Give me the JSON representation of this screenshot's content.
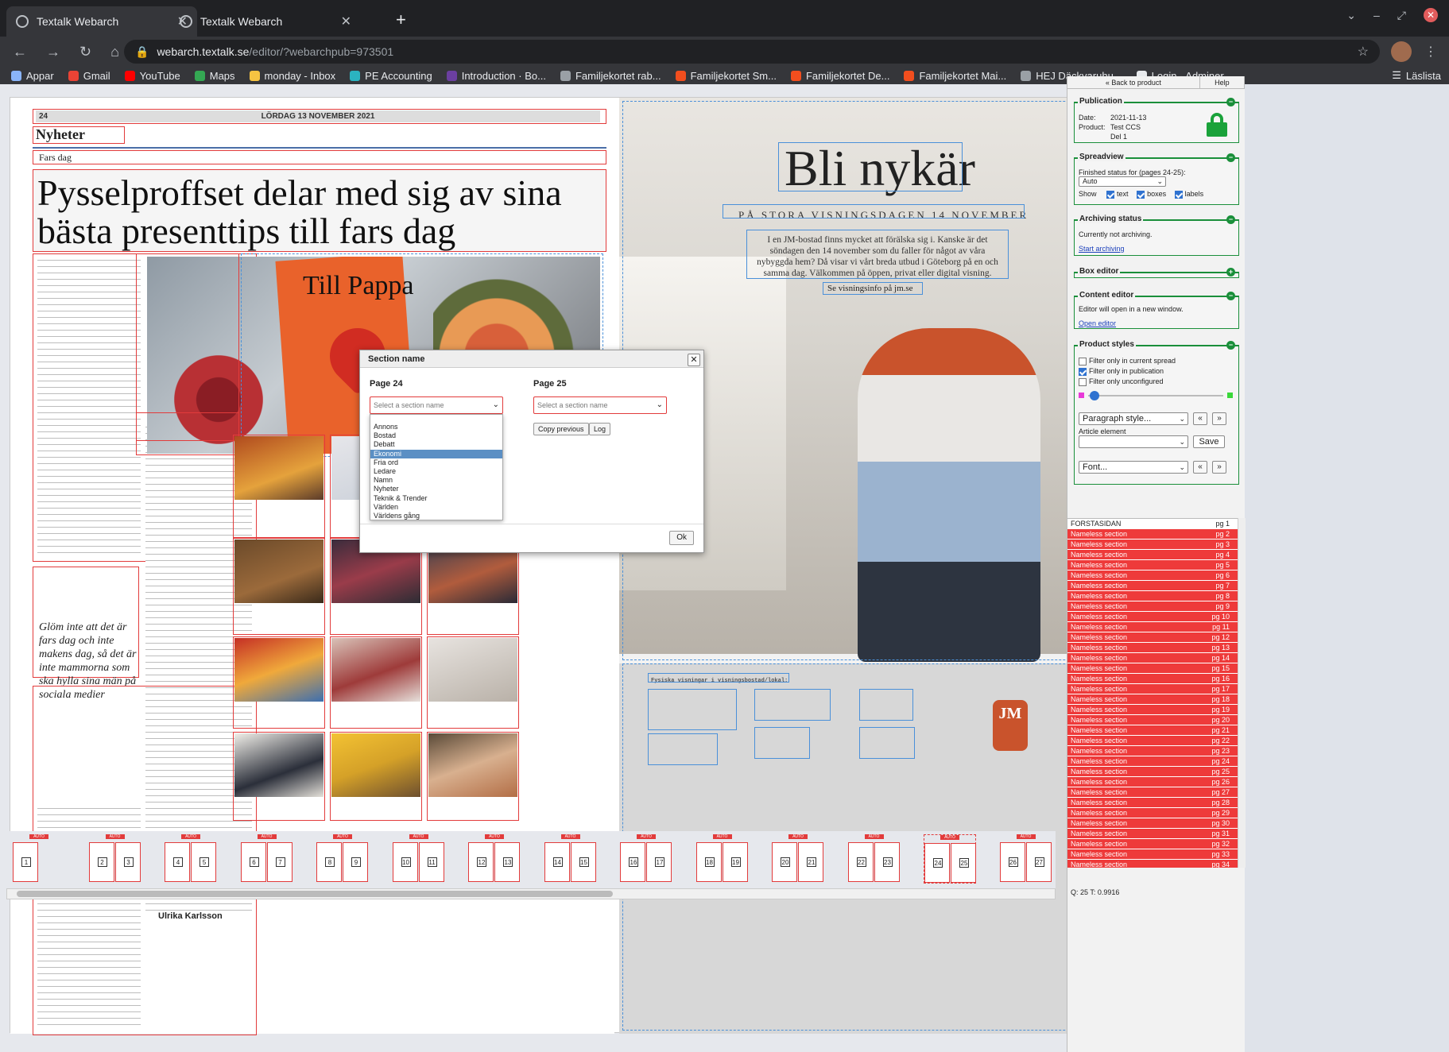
{
  "browser": {
    "tabs": [
      {
        "title": "Textalk Webarch"
      },
      {
        "title": "Textalk Webarch"
      }
    ],
    "url_host": "webarch.textalk.se",
    "url_path": "/editor/?webarchpub=973501",
    "bookmarks": [
      "Appar",
      "Gmail",
      "YouTube",
      "Maps",
      "monday - Inbox",
      "PE Accounting",
      "Introduction · Bo...",
      "Familjekortet rab...",
      "Familjekortet Sm...",
      "Familjekortet De...",
      "Familjekortet Mai...",
      "HEJ Däckvaruhu...",
      "Login - Adminer"
    ],
    "reading_list": "Läslista"
  },
  "page24": {
    "number": "24",
    "date": "LÖRDAG 13 NOVEMBER 2021",
    "section": "Nyheter",
    "kicker": "Fars dag",
    "headline": "Pysselproffset delar med sig av sina bästa presenttips till fars dag",
    "photo_text": "Till Pappa",
    "quote": "Glöm inte att det är fars dag och inte makens dag, så det är inte mammorna som ska hylla sina män på sociala medier",
    "byline": "Ulrika Karlsson"
  },
  "page25": {
    "title": "Bli nykär",
    "subtitle": "PÅ STORA VISNINGSDAGEN 14 NOVEMBER",
    "body": "I en JM-bostad finns mycket att förälska sig i. Kanske är det söndagen den 14 november som du faller för något av våra nybyggda hem? Då visar vi vårt breda utbud i Göteborg på en och samma dag. Välkommen på öppen, privat eller digital visning.",
    "link": "Se visningsinfo på jm.se",
    "bottom_head": "Fysiska visningar i visningsbostad/lokal:",
    "logo": "JM"
  },
  "modal": {
    "title": "Section name",
    "page_left": "Page 24",
    "page_right": "Page 25",
    "placeholder": "Select a section name",
    "options": [
      "Annons",
      "Bostad",
      "Debatt",
      "Ekonomi",
      "Fria ord",
      "Ledare",
      "Namn",
      "Nyheter",
      "Teknik & Trender",
      "Världen",
      "Världens gång"
    ],
    "highlighted": "Ekonomi",
    "copy_previous": "Copy previous",
    "log": "Log",
    "ok": "Ok"
  },
  "thumbs": {
    "label": "AUTO",
    "spreads": [
      [
        "1"
      ],
      [
        "2",
        "3"
      ],
      [
        "4",
        "5"
      ],
      [
        "6",
        "7"
      ],
      [
        "8",
        "9"
      ],
      [
        "10",
        "11"
      ],
      [
        "12",
        "13"
      ],
      [
        "14",
        "15"
      ],
      [
        "16",
        "17"
      ],
      [
        "18",
        "19"
      ],
      [
        "20",
        "21"
      ],
      [
        "22",
        "23"
      ],
      [
        "24",
        "25"
      ],
      [
        "26",
        "27"
      ]
    ]
  },
  "sidebar": {
    "back": "« Back to product",
    "help": "Help",
    "publication": {
      "title": "Publication",
      "date_label": "Date:",
      "date": "2021-11-13",
      "product_label": "Product:",
      "product": "Test CCS",
      "part": "Del 1"
    },
    "spreadview": {
      "title": "Spreadview",
      "finished_label": "Finished status for (pages 24-25):",
      "finished_value": "Auto",
      "show": "Show",
      "text": "text",
      "boxes": "boxes",
      "labels": "labels"
    },
    "archiving": {
      "title": "Archiving status",
      "status": "Currently not archiving.",
      "link": "Start archiving"
    },
    "box_editor": {
      "title": "Box editor"
    },
    "content_editor": {
      "title": "Content editor",
      "text": "Editor will open in a new window.",
      "link": "Open editor"
    },
    "product_styles": {
      "title": "Product styles",
      "filter1": "Filter only in current spread",
      "filter2": "Filter only in publication",
      "filter3": "Filter only unconfigured",
      "paragraph": "Paragraph style...",
      "article_element": "Article element",
      "save": "Save",
      "font": "Font...",
      "prev": "«",
      "next": "»"
    },
    "sections": [
      {
        "name": "FORSTASIDAN",
        "pg": "pg 1",
        "red": false
      },
      {
        "name": "Nameless section",
        "pg": "pg 2",
        "red": true
      },
      {
        "name": "Nameless section",
        "pg": "pg 3",
        "red": true
      },
      {
        "name": "Nameless section",
        "pg": "pg 4",
        "red": true
      },
      {
        "name": "Nameless section",
        "pg": "pg 5",
        "red": true
      },
      {
        "name": "Nameless section",
        "pg": "pg 6",
        "red": true
      },
      {
        "name": "Nameless section",
        "pg": "pg 7",
        "red": true
      },
      {
        "name": "Nameless section",
        "pg": "pg 8",
        "red": true
      },
      {
        "name": "Nameless section",
        "pg": "pg 9",
        "red": true
      },
      {
        "name": "Nameless section",
        "pg": "pg 10",
        "red": true
      },
      {
        "name": "Nameless section",
        "pg": "pg 11",
        "red": true
      },
      {
        "name": "Nameless section",
        "pg": "pg 12",
        "red": true
      },
      {
        "name": "Nameless section",
        "pg": "pg 13",
        "red": true
      },
      {
        "name": "Nameless section",
        "pg": "pg 14",
        "red": true
      },
      {
        "name": "Nameless section",
        "pg": "pg 15",
        "red": true
      },
      {
        "name": "Nameless section",
        "pg": "pg 16",
        "red": true
      },
      {
        "name": "Nameless section",
        "pg": "pg 17",
        "red": true
      },
      {
        "name": "Nameless section",
        "pg": "pg 18",
        "red": true
      },
      {
        "name": "Nameless section",
        "pg": "pg 19",
        "red": true
      },
      {
        "name": "Nameless section",
        "pg": "pg 20",
        "red": true
      },
      {
        "name": "Nameless section",
        "pg": "pg 21",
        "red": true
      },
      {
        "name": "Nameless section",
        "pg": "pg 22",
        "red": true
      },
      {
        "name": "Nameless section",
        "pg": "pg 23",
        "red": true
      },
      {
        "name": "Nameless section",
        "pg": "pg 24",
        "red": true
      },
      {
        "name": "Nameless section",
        "pg": "pg 25",
        "red": true
      },
      {
        "name": "Nameless section",
        "pg": "pg 26",
        "red": true
      },
      {
        "name": "Nameless section",
        "pg": "pg 27",
        "red": true
      },
      {
        "name": "Nameless section",
        "pg": "pg 28",
        "red": true
      },
      {
        "name": "Nameless section",
        "pg": "pg 29",
        "red": true
      },
      {
        "name": "Nameless section",
        "pg": "pg 30",
        "red": true
      },
      {
        "name": "Nameless section",
        "pg": "pg 31",
        "red": true
      },
      {
        "name": "Nameless section",
        "pg": "pg 32",
        "red": true
      },
      {
        "name": "Nameless section",
        "pg": "pg 33",
        "red": true
      },
      {
        "name": "Nameless section",
        "pg": "pg 34",
        "red": true
      }
    ],
    "status": "Q: 25 T: 0.9916"
  },
  "colors": {
    "accent_red": "#e23b3b",
    "accent_green": "#1a8f3a",
    "accent_blue": "#4a90d9"
  }
}
